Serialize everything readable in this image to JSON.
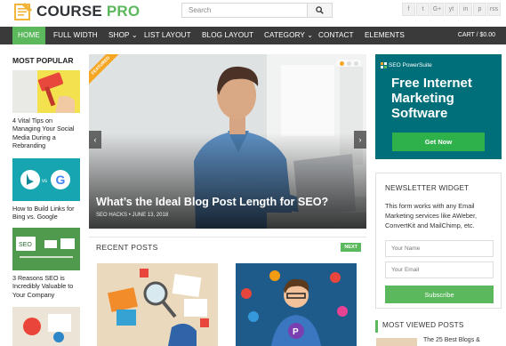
{
  "brand": {
    "word1": "COURSE",
    "word2": "PRO",
    "accent": "#5cb85c"
  },
  "search": {
    "placeholder": "Search"
  },
  "socials": [
    "f",
    "t",
    "G+",
    "yt",
    "in",
    "p",
    "rss"
  ],
  "nav": {
    "items": [
      {
        "label": "HOME",
        "active": true
      },
      {
        "label": "FULL WIDTH"
      },
      {
        "label": "SHOP ⌄"
      },
      {
        "label": "LIST LAYOUT"
      },
      {
        "label": "BLOG LAYOUT"
      },
      {
        "label": "CATEGORY ⌄"
      },
      {
        "label": "CONTACT"
      },
      {
        "label": "ELEMENTS"
      }
    ],
    "cart": "CART / $0.00"
  },
  "most_popular": {
    "title": "MOST POPULAR",
    "posts": [
      {
        "title": "4 Vital Tips on Managing Your Social Media During a Rebranding"
      },
      {
        "title": "How to Build Links for Bing vs. Google"
      },
      {
        "title": "3 Reasons SEO is Incredibly Valuable to Your Company"
      }
    ]
  },
  "slider": {
    "tag": "FEATURED",
    "title": "What’s the Ideal Blog Post Length for SEO?",
    "category": "SEO HACKS",
    "date": "JUNE 13, 2018",
    "prev": "‹",
    "next": "›"
  },
  "recent": {
    "title": "RECENT POSTS",
    "next_label": "NEXT"
  },
  "ad": {
    "brand": "SEO PowerSuite",
    "headline": "Free Internet Marketing Software",
    "button": "Get Now"
  },
  "newsletter": {
    "title": "NEWSLETTER WIDGET",
    "text": "This form works with any Email Marketing services like AWeber, ConvertKit and MailChimp, etc.",
    "name_placeholder": "Your Name",
    "email_placeholder": "Your Email",
    "button": "Subscribe"
  },
  "most_viewed": {
    "title": "MOST VIEWED POSTS",
    "first_post": "The 25 Best Blogs &"
  }
}
